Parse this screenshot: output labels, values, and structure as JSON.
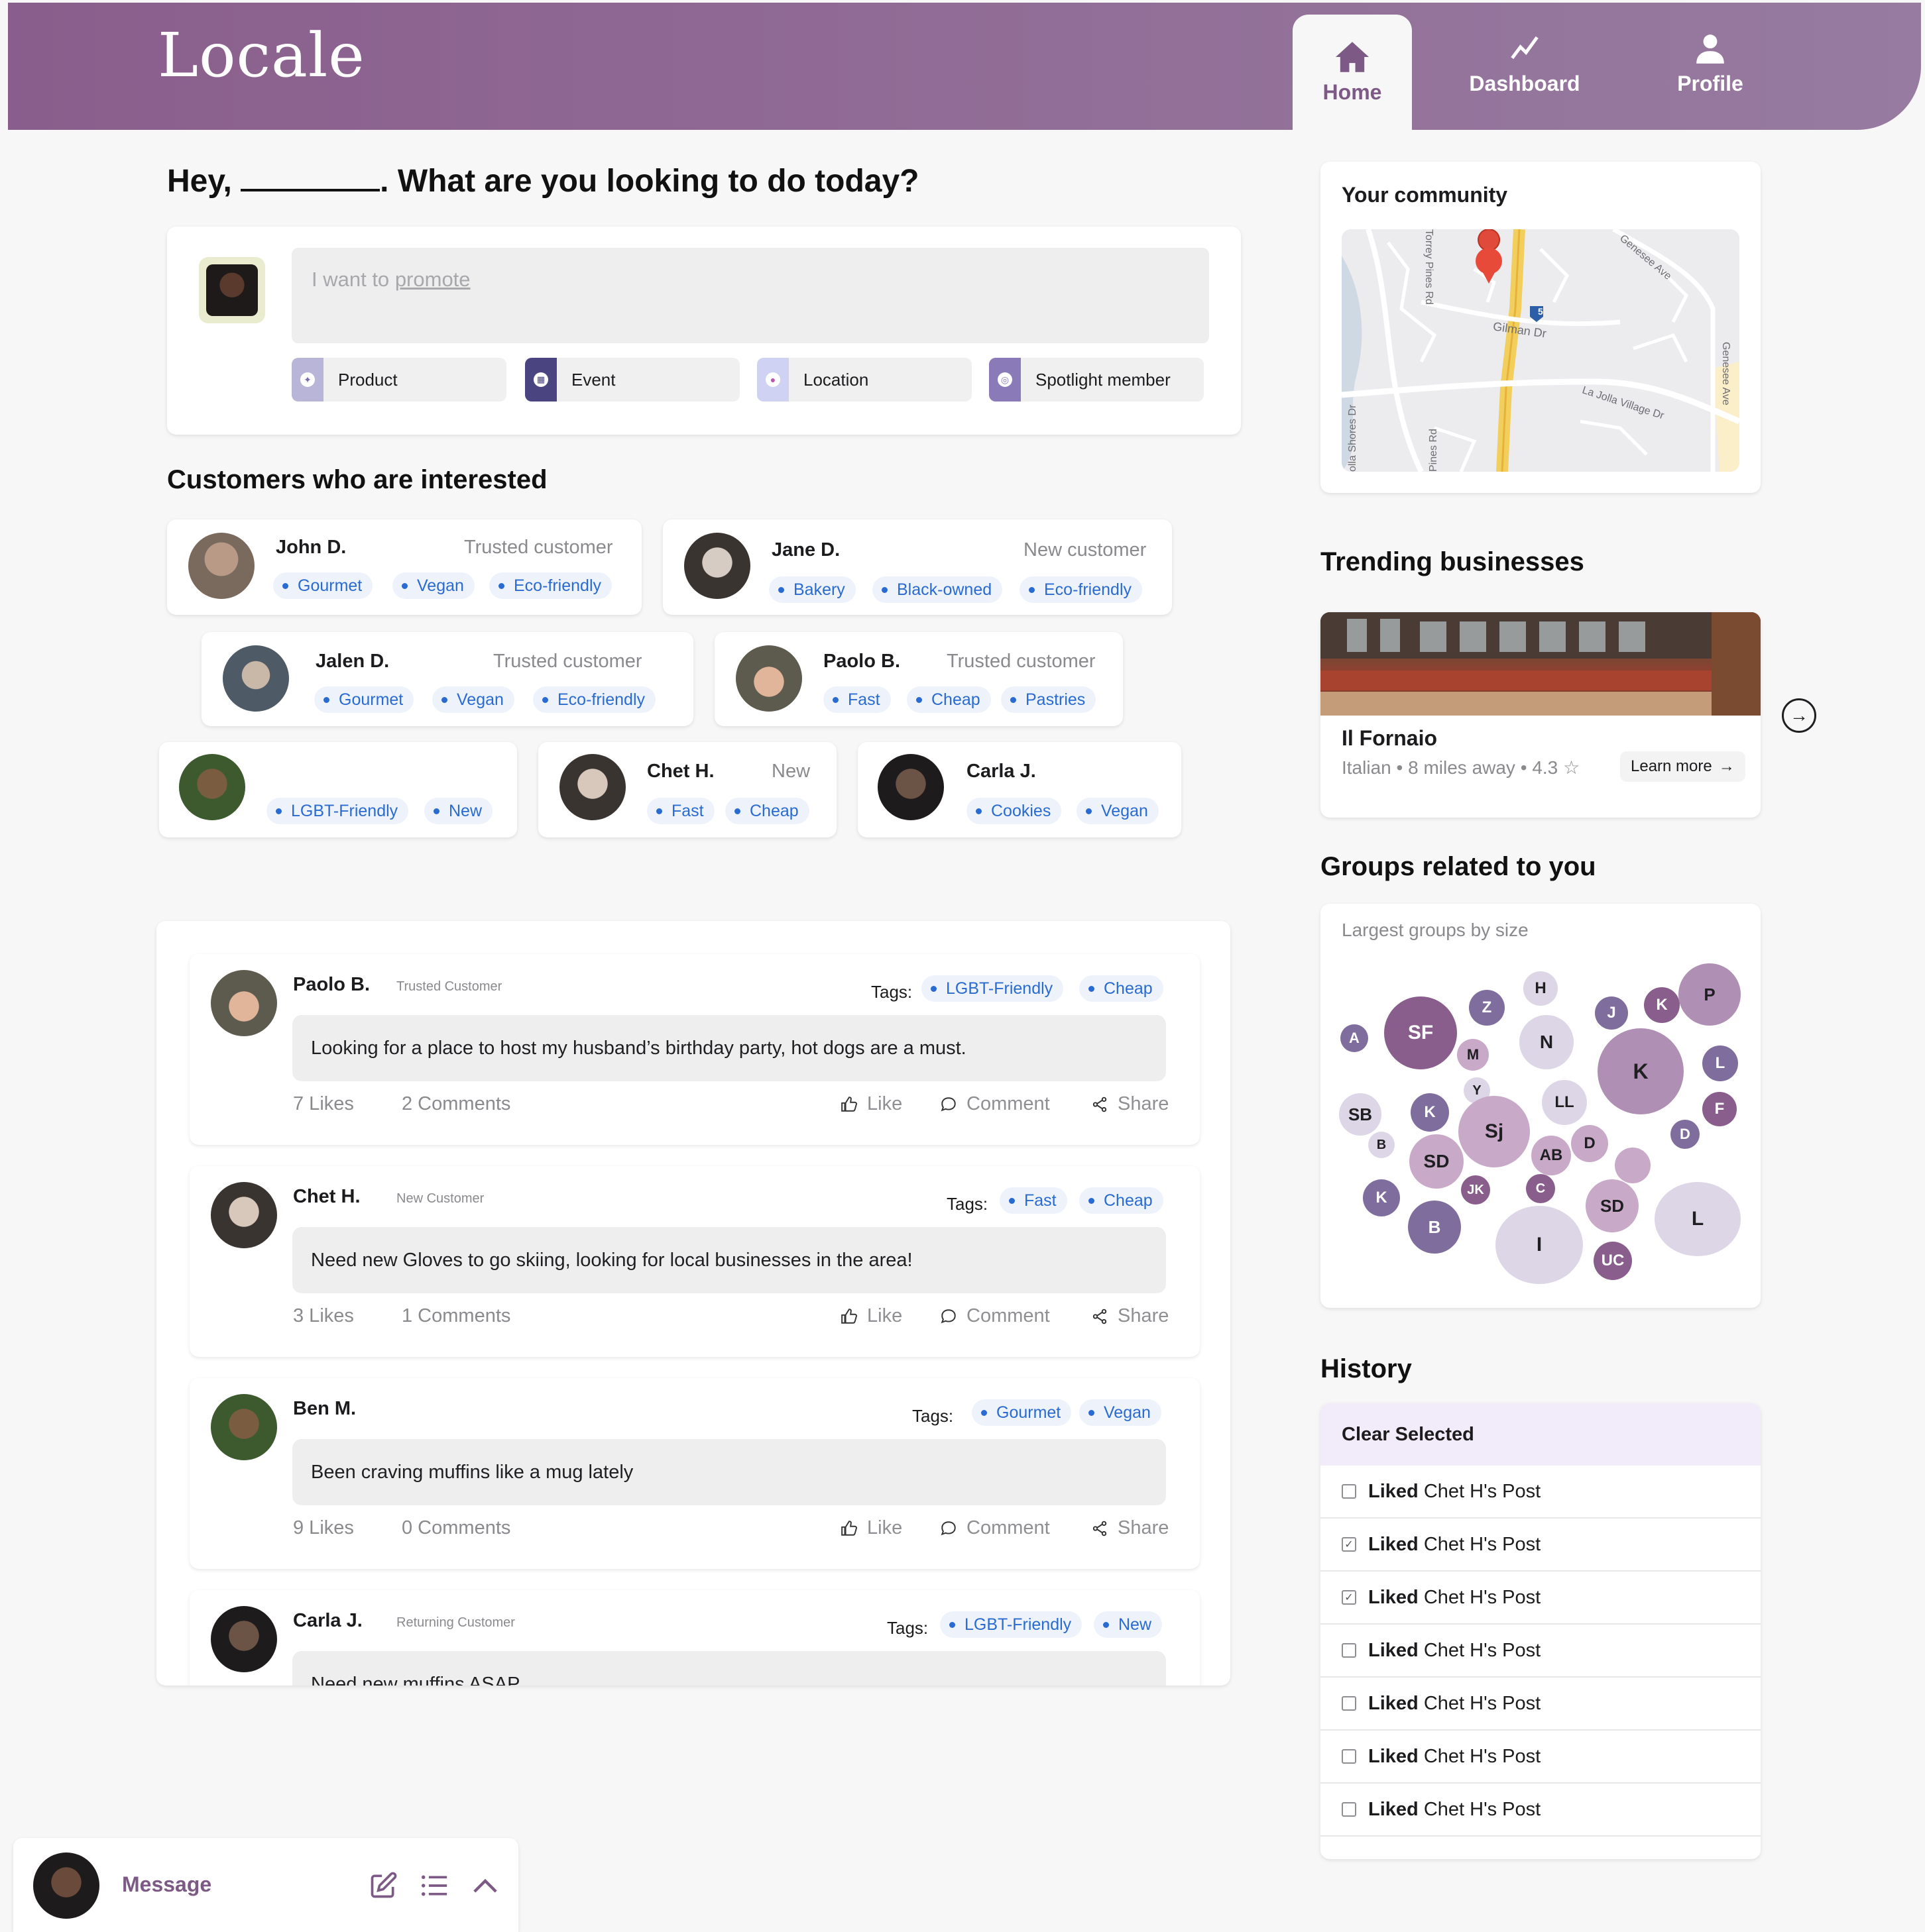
{
  "app": {
    "logo": "Locale"
  },
  "nav": [
    {
      "label": "Home",
      "icon": "home-icon",
      "active": true
    },
    {
      "label": "Dashboard",
      "icon": "trend-icon"
    },
    {
      "label": "Profile",
      "icon": "user-icon"
    }
  ],
  "greeting": {
    "prefix": "Hey,",
    "suffix": ". What are you looking to do today?"
  },
  "promote": {
    "placeholder_text": "I want to",
    "placeholder_link": "promote",
    "options": [
      "Product",
      "Event",
      "Location",
      "Spotlight member"
    ]
  },
  "customers_title": "Customers who are interested",
  "customers": [
    {
      "name": "John D.",
      "status": "Trusted customer",
      "tags": [
        "Gourmet",
        "Vegan",
        "Eco-friendly"
      ]
    },
    {
      "name": "Jane D.",
      "status": "New customer",
      "tags": [
        "Bakery",
        "Black-owned",
        "Eco-friendly"
      ]
    },
    {
      "name": "Jalen D.",
      "status": "Trusted customer",
      "tags": [
        "Gourmet",
        "Vegan",
        "Eco-friendly"
      ]
    },
    {
      "name": "Paolo B.",
      "status": "Trusted customer",
      "tags": [
        "Fast",
        "Cheap",
        "Pastries"
      ]
    },
    {
      "name": "",
      "status": "",
      "tags": [
        "LGBT-Friendly",
        "New"
      ]
    },
    {
      "name": "Chet H.",
      "status": "New",
      "tags": [
        "Fast",
        "Cheap"
      ]
    },
    {
      "name": "Carla J.",
      "status": "",
      "tags": [
        "Cookies",
        "Vegan"
      ]
    }
  ],
  "posts": [
    {
      "name": "Paolo B.",
      "status": "Trusted Customer",
      "tags_label": "Tags:",
      "tags": [
        "LGBT-Friendly",
        "Cheap"
      ],
      "text": "Looking for a place to host my husband’s birthday party, hot dogs are a must.",
      "likes": "7 Likes",
      "comments": "2 Comments"
    },
    {
      "name": "Chet H.",
      "status": "New Customer",
      "tags_label": "Tags:",
      "tags": [
        "Fast",
        "Cheap"
      ],
      "text": "Need new Gloves to go skiing, looking for local businesses in the area!",
      "likes": "3 Likes",
      "comments": "1 Comments"
    },
    {
      "name": "Ben M.",
      "status": "",
      "tags_label": "Tags:",
      "tags": [
        "Gourmet",
        "Vegan"
      ],
      "text": "Been craving muffins like a mug lately",
      "likes": "9 Likes",
      "comments": "0 Comments"
    },
    {
      "name": "Carla J.",
      "status": "Returning Customer",
      "tags_label": "Tags:",
      "tags": [
        "LGBT-Friendly",
        "New"
      ],
      "text": "Need new muffins ASAP",
      "likes": "",
      "comments": ""
    }
  ],
  "post_actions": {
    "like": "Like",
    "comment": "Comment",
    "share": "Share"
  },
  "community": {
    "title": "Your community",
    "map_labels": [
      "Torrey Pines Rd",
      "Genesee Ave",
      "Gilman Dr",
      "5",
      "La Jolla Village Dr",
      "Genesee Ave",
      "Pines Rd",
      "olla Shores Dr"
    ]
  },
  "trending": {
    "title": "Trending businesses",
    "name": "Il Fornaio",
    "cuisine": "Italian",
    "distance": "8 miles away",
    "rating": "4.3",
    "cta": "Learn more"
  },
  "groups": {
    "title": "Groups related to you",
    "subtitle": "Largest groups by size",
    "bubbles": [
      "A",
      "SF",
      "Z",
      "H",
      "J",
      "K",
      "P",
      "M",
      "N",
      "L",
      "SB",
      "K",
      "Y",
      "K",
      "LL",
      "F",
      "Sj",
      "B",
      "SD",
      "D",
      "AB",
      "D",
      "K",
      "JK",
      "C",
      "SD",
      "L",
      "B",
      "I",
      "UC"
    ]
  },
  "history": {
    "title": "History",
    "clear": "Clear Selected",
    "items": [
      {
        "verb": "Liked",
        "text": "Chet H's Post",
        "checked": false
      },
      {
        "verb": "Liked",
        "text": "Chet H's Post",
        "checked": true
      },
      {
        "verb": "Liked",
        "text": "Chet H's Post",
        "checked": true
      },
      {
        "verb": "Liked",
        "text": "Chet H's Post",
        "checked": false
      },
      {
        "verb": "Liked",
        "text": "Chet H's Post",
        "checked": false
      },
      {
        "verb": "Liked",
        "text": "Chet H's Post",
        "checked": false
      },
      {
        "verb": "Liked",
        "text": "Chet H's Post",
        "checked": false
      }
    ]
  },
  "message_bar": {
    "label": "Message"
  },
  "colors": {
    "brand": "#8a5e8c",
    "tag_blue": "#2a6bd1",
    "accent_light": "#f2ecfa"
  }
}
